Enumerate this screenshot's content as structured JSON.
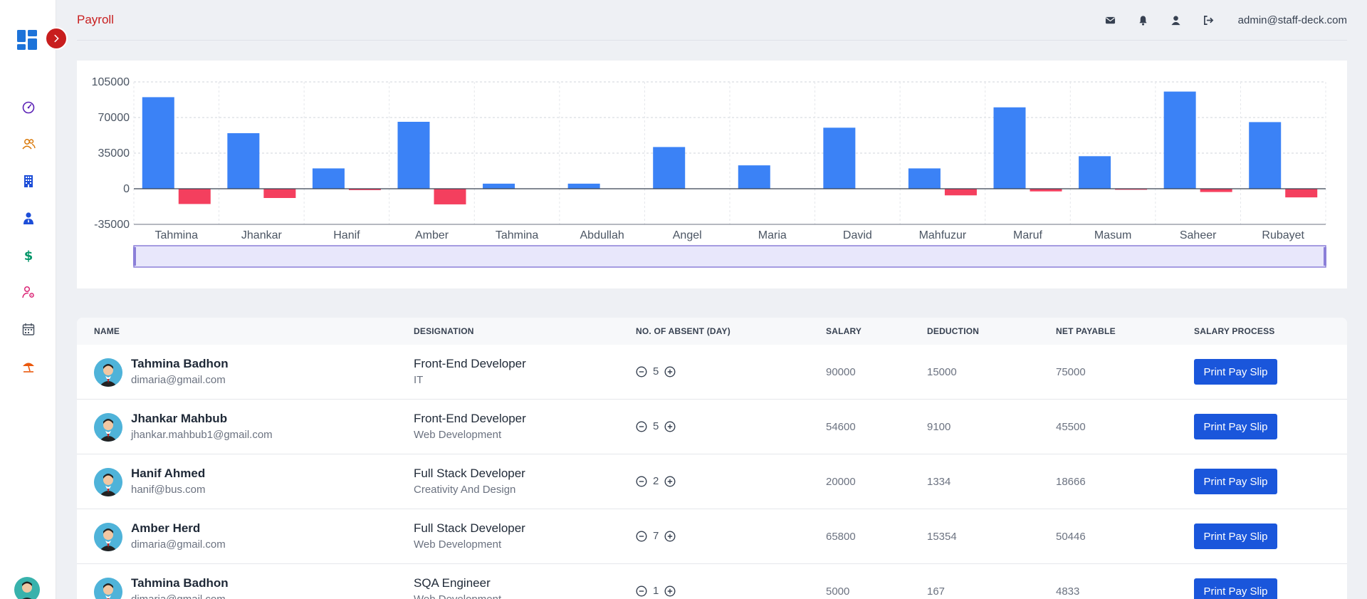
{
  "header": {
    "title": "Payroll",
    "user_email": "admin@staff-deck.com",
    "icons": [
      "mail-icon",
      "bell-icon",
      "user-icon",
      "logout-icon"
    ]
  },
  "sidebar": {
    "items": [
      {
        "icon": "dashboard-gauge-icon",
        "color": "#5b21b6"
      },
      {
        "icon": "users-icon",
        "color": "#d97706"
      },
      {
        "icon": "building-icon",
        "color": "#1d4ed8"
      },
      {
        "icon": "employee-icon",
        "color": "#1d4ed8"
      },
      {
        "icon": "dollar-icon",
        "color": "#059669"
      },
      {
        "icon": "user-settings-icon",
        "color": "#db2777"
      },
      {
        "icon": "calendar-icon",
        "color": "#4b5563"
      },
      {
        "icon": "holiday-umbrella-icon",
        "color": "#ea580c"
      }
    ]
  },
  "chart_data": {
    "type": "bar",
    "categories": [
      "Tahmina",
      "Jhankar",
      "Hanif",
      "Amber",
      "Tahmina",
      "Abdullah",
      "Angel",
      "Maria",
      "David",
      "Mahfuzur",
      "Maruf",
      "Masum",
      "Saheer",
      "Rubayet"
    ],
    "series": [
      {
        "values": [
          90000,
          54600,
          20000,
          65800,
          5000,
          5000,
          41000,
          23000,
          60000,
          20000,
          80000,
          32000,
          95500,
          65500
        ],
        "color": "#3b82f6"
      },
      {
        "values": [
          -15000,
          -9100,
          -1334,
          -15354,
          0,
          0,
          0,
          0,
          0,
          -6500,
          -2600,
          -1000,
          -3200,
          -8500
        ],
        "color": "#f43f5e"
      }
    ],
    "ylim": [
      -35000,
      105000
    ],
    "yticks": [
      105000,
      70000,
      35000,
      0,
      -35000
    ],
    "grid": true
  },
  "table": {
    "columns": [
      "NAME",
      "DESIGNATION",
      "NO. OF ABSENT (DAY)",
      "SALARY",
      "DEDUCTION",
      "NET PAYABLE",
      "SALARY PROCESS"
    ],
    "button_label": "Print Pay Slip",
    "rows": [
      {
        "name": "Tahmina Badhon",
        "email": "dimaria@gmail.com",
        "designation": "Front-End Developer",
        "department": "IT",
        "absent": "5",
        "salary": "90000",
        "deduction": "15000",
        "net": "75000"
      },
      {
        "name": "Jhankar Mahbub",
        "email": "jhankar.mahbub1@gmail.com",
        "designation": "Front-End Developer",
        "department": "Web Development",
        "absent": "5",
        "salary": "54600",
        "deduction": "9100",
        "net": "45500"
      },
      {
        "name": "Hanif Ahmed",
        "email": "hanif@bus.com",
        "designation": "Full Stack Developer",
        "department": "Creativity And Design",
        "absent": "2",
        "salary": "20000",
        "deduction": "1334",
        "net": "18666"
      },
      {
        "name": "Amber Herd",
        "email": "dimaria@gmail.com",
        "designation": "Full Stack Developer",
        "department": "Web Development",
        "absent": "7",
        "salary": "65800",
        "deduction": "15354",
        "net": "50446"
      },
      {
        "name": "Tahmina Badhon",
        "email": "dimaria@gmail.com",
        "designation": "SQA Engineer",
        "department": "Web Development",
        "absent": "1",
        "salary": "5000",
        "deduction": "167",
        "net": "4833"
      }
    ]
  }
}
